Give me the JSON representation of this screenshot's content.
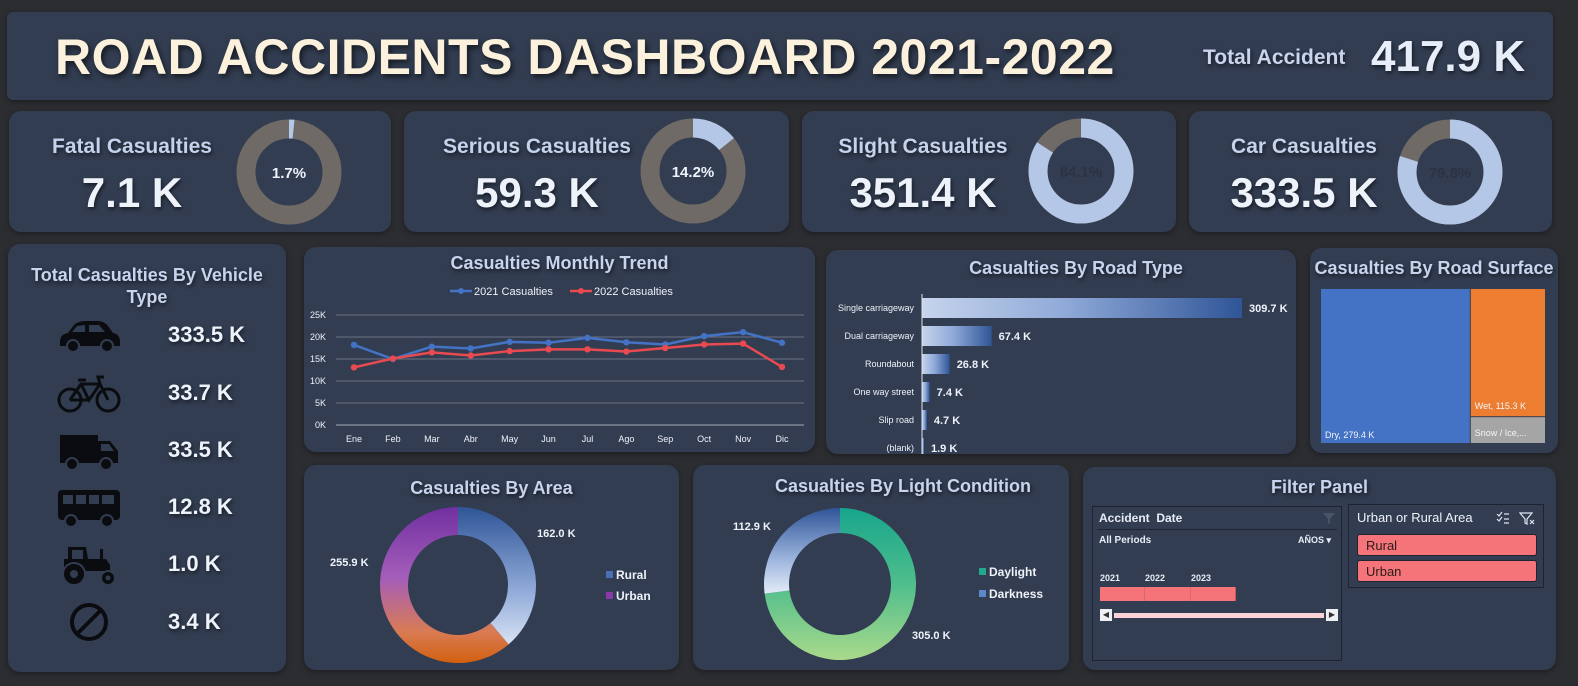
{
  "header": {
    "title": "ROAD ACCIDENTS DASHBOARD 2021-2022",
    "total_label": "Total Accident",
    "total_value": "417.9 K"
  },
  "kpis": [
    {
      "title": "Fatal Casualties",
      "value": "7.1 K",
      "pct_label": "1.7%",
      "pct": 1.7
    },
    {
      "title": "Serious Casualties",
      "value": "59.3 K",
      "pct_label": "14.2%",
      "pct": 14.2
    },
    {
      "title": "Slight Casualties",
      "value": "351.4 K",
      "pct_label": "84.1%",
      "pct": 84.1
    },
    {
      "title": "Car Casualties",
      "value": "333.5 K",
      "pct_label": "79.8%",
      "pct": 79.8
    }
  ],
  "vehicle": {
    "title": "Total Casualties By Vehicle Type",
    "rows": [
      {
        "icon": "car-icon",
        "value": "333.5 K"
      },
      {
        "icon": "bicycle-icon",
        "value": "33.7 K"
      },
      {
        "icon": "van-icon",
        "value": "33.5 K"
      },
      {
        "icon": "bus-icon",
        "value": "12.8 K"
      },
      {
        "icon": "tractor-icon",
        "value": "1.0 K"
      },
      {
        "icon": "prohibited-icon",
        "value": "3.4 K"
      }
    ]
  },
  "colors": {
    "series_2021": "#4472c4",
    "series_2022": "#e84a50",
    "light_blue": "#b4c7e7",
    "grey": "#6f6a66",
    "orange": "#ed7d31",
    "slicer": "#f47479"
  },
  "chart_data": [
    {
      "type": "line",
      "title": "Casualties Monthly Trend",
      "categories": [
        "Ene",
        "Feb",
        "Mar",
        "Abr",
        "May",
        "Jun",
        "Jul",
        "Ago",
        "Sep",
        "Oct",
        "Nov",
        "Dic"
      ],
      "series": [
        {
          "name": "2021 Casualties",
          "values": [
            18200,
            15000,
            17800,
            17400,
            18900,
            18700,
            19800,
            18800,
            18300,
            20200,
            21100,
            18700
          ]
        },
        {
          "name": "2022 Casualties",
          "values": [
            13100,
            15100,
            16500,
            15800,
            16800,
            17200,
            17200,
            16700,
            17500,
            18300,
            18500,
            13200
          ]
        }
      ],
      "yticks": [
        "0K",
        "5K",
        "10K",
        "15K",
        "20K",
        "25K"
      ],
      "ylim": [
        0,
        25000
      ],
      "grid": true,
      "legend": "top"
    },
    {
      "type": "bar",
      "title": "Casualties By Road Type",
      "categories": [
        "Single carriageway",
        "Dual carriageway",
        "Roundabout",
        "One way street",
        "Slip road",
        "(blank)"
      ],
      "values": [
        309.7,
        67.4,
        26.8,
        7.4,
        4.7,
        1.9
      ],
      "value_labels": [
        "309.7 K",
        "67.4 K",
        "26.8 K",
        "7.4 K",
        "4.7 K",
        "1.9 K"
      ],
      "orientation": "horizontal"
    },
    {
      "type": "treemap",
      "title": "Casualties By Road Surface",
      "labels": [
        "Dry, 279.4 K",
        "Wet, 115.3 K",
        "Snow / Ice,..."
      ],
      "values": [
        279.4,
        115.3,
        23.2
      ]
    },
    {
      "type": "pie",
      "title": "Casualties By Area",
      "labels": [
        "Rural",
        "Urban"
      ],
      "values": [
        162.0,
        255.9
      ],
      "value_labels": [
        "162.0 K",
        "255.9 K"
      ],
      "legend": "right"
    },
    {
      "type": "pie",
      "title": "Casualties By Light Condition",
      "labels": [
        "Daylight",
        "Darkness"
      ],
      "values": [
        305.0,
        112.9
      ],
      "value_labels": [
        "305.0 K",
        "112.9 K"
      ],
      "legend": "right"
    }
  ],
  "filter": {
    "title": "Filter Panel",
    "timeline_title": "Accident  Date",
    "period_label": "All Periods",
    "period_unit": "AÑOS",
    "years": [
      "2021",
      "2022",
      "2023"
    ],
    "slicer_title": "Urban or Rural Area",
    "slicer_items": [
      "Rural",
      "Urban"
    ]
  }
}
